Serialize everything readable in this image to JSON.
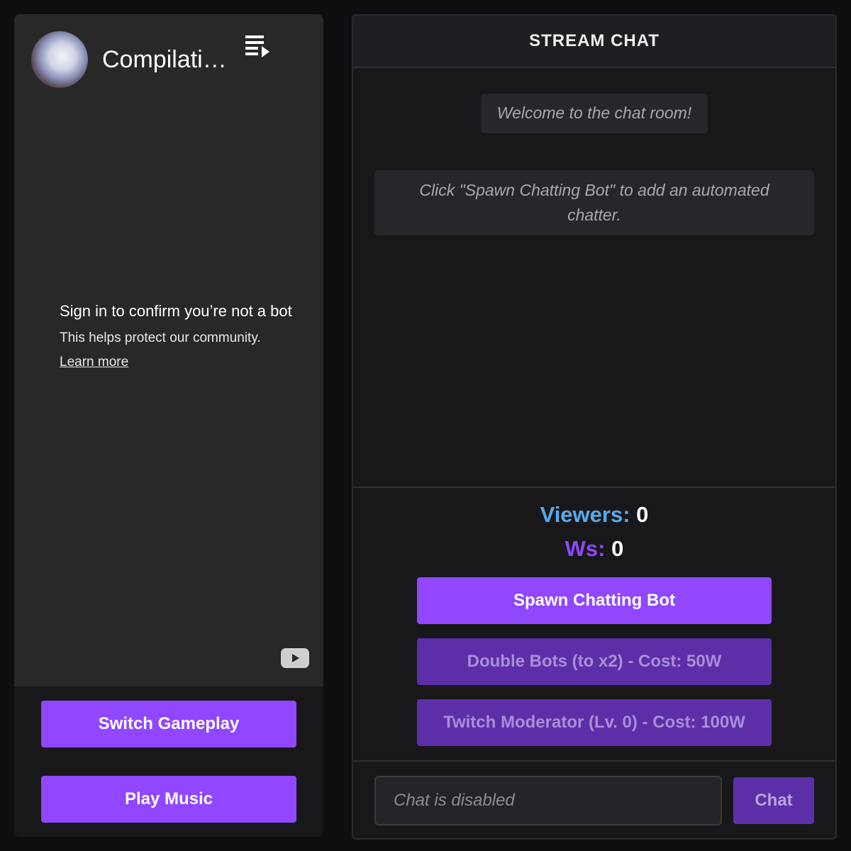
{
  "player": {
    "title": "Compilati…",
    "signin_title": "Sign in to confirm you’re not a bot",
    "signin_subtitle": "This helps protect our community.",
    "learn_more": "Learn more",
    "icons": [
      "channel-avatar",
      "playlist-icon",
      "youtube-logo-icon"
    ]
  },
  "left_buttons": {
    "switch_gameplay": "Switch Gameplay",
    "play_music": "Play Music"
  },
  "chat": {
    "header": "STREAM CHAT",
    "messages": [
      "Welcome to the chat room!",
      "Click \"Spawn Chatting Bot\" to add an automated chatter."
    ],
    "stats": {
      "viewers_label": "Viewers:",
      "viewers_value": "0",
      "ws_label": "Ws:",
      "ws_value": "0"
    },
    "actions": {
      "spawn": "Spawn Chatting Bot",
      "double": "Double Bots (to x2) - Cost: 50W",
      "moderator": "Twitch Moderator (Lv. 0) - Cost: 100W"
    },
    "input_placeholder": "Chat is disabled",
    "send_label": "Chat"
  },
  "colors": {
    "accent": "#9147ff",
    "accent_disabled": "#5c2fa8",
    "viewers_label": "#5aa9ea",
    "background": "#0e0e10"
  }
}
